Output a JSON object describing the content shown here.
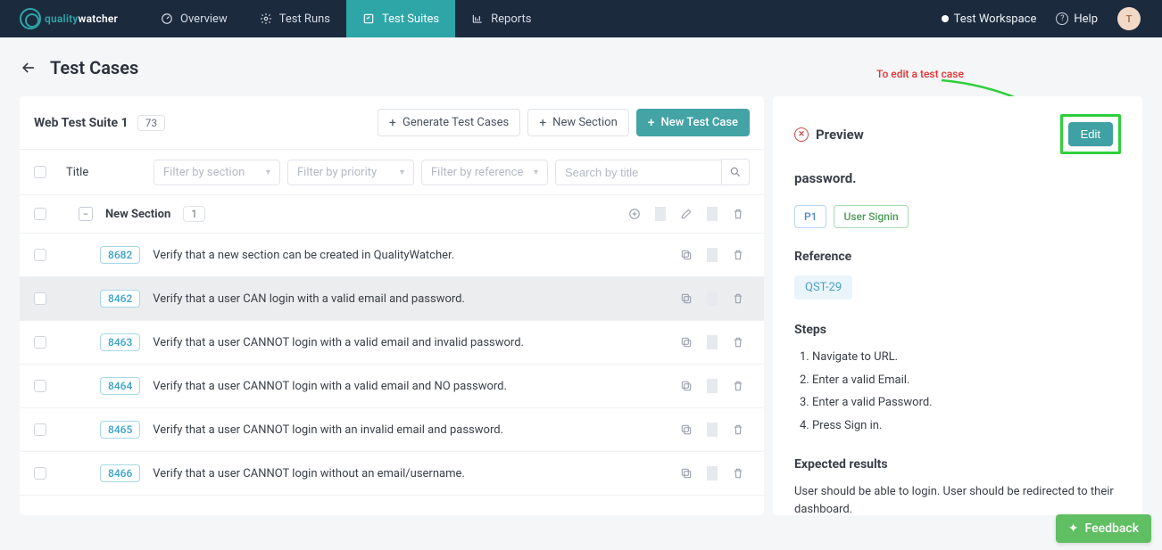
{
  "nav": {
    "logo_a": "quality",
    "logo_b": "watcher",
    "items": [
      {
        "label": "Overview"
      },
      {
        "label": "Test Runs"
      },
      {
        "label": "Test Suites"
      },
      {
        "label": "Reports"
      }
    ],
    "workspace": "Test Workspace",
    "help": "Help",
    "avatar": "T"
  },
  "page": {
    "title": "Test Cases"
  },
  "suite": {
    "name": "Web Test Suite 1",
    "count": "73",
    "btn_generate": "Generate Test Cases",
    "btn_new_section": "New Section",
    "btn_new_tc": "New Test Case"
  },
  "filters": {
    "title_col": "Title",
    "section_ph": "Filter by section",
    "priority_ph": "Filter by priority",
    "reference_ph": "Filter by reference",
    "search_ph": "Search by title"
  },
  "section": {
    "name": "New Section",
    "count": "1"
  },
  "cases": [
    {
      "id": "8682",
      "title": "Verify that a new section can be created in QualityWatcher."
    },
    {
      "id": "8462",
      "title": "Verify that a user CAN login with a valid email and password."
    },
    {
      "id": "8463",
      "title": "Verify that a user CANNOT login with a valid email and invalid password."
    },
    {
      "id": "8464",
      "title": "Verify that a user CANNOT login with a valid email and NO password."
    },
    {
      "id": "8465",
      "title": "Verify that a user CANNOT login with an invalid email and password."
    },
    {
      "id": "8466",
      "title": "Verify that a user CANNOT login without an email/username."
    }
  ],
  "preview": {
    "label": "Preview",
    "edit": "Edit",
    "truncated_title_tail": "password.",
    "p1": "P1",
    "signin": "User Signin",
    "reference_h": "Reference",
    "reference": "QST-29",
    "steps_h": "Steps",
    "steps": [
      "Navigate to URL.",
      "Enter a valid Email.",
      "Enter a valid Password.",
      "Press Sign in."
    ],
    "expected_h": "Expected results",
    "expected": "User should be able to login. User should be redirected to their dashboard."
  },
  "annotation": "To edit a test case",
  "feedback": "Feedback"
}
